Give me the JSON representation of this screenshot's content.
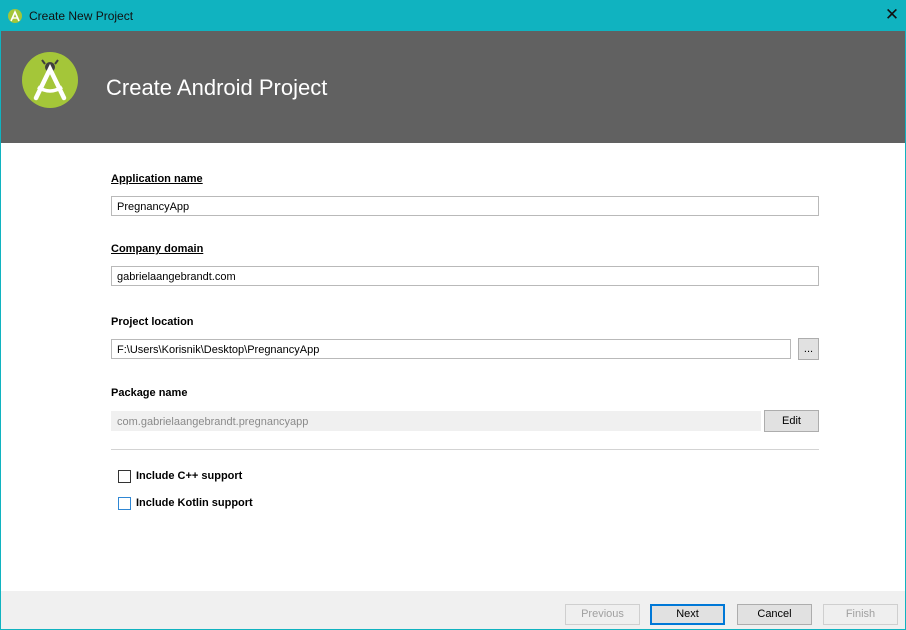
{
  "window": {
    "title": "Create New Project",
    "close_glyph": "✕"
  },
  "banner": {
    "title": "Create Android Project",
    "logo_icon": "android-studio-icon"
  },
  "form": {
    "app_name_label": "Application name",
    "app_name_value": "PregnancyApp",
    "company_domain_label": "Company domain",
    "company_domain_value": "gabrielaangebrandt.com",
    "project_location_label": "Project location",
    "project_location_value": "F:\\Users\\Korisnik\\Desktop\\PregnancyApp",
    "browse_label": "...",
    "package_name_label": "Package name",
    "package_name_value": "com.gabrielaangebrandt.pregnancyapp",
    "edit_label": "Edit",
    "include_cpp_label": "Include C++ support",
    "include_cpp_checked": false,
    "include_kotlin_label": "Include Kotlin support",
    "include_kotlin_checked": false
  },
  "footer": {
    "previous_label": "Previous",
    "next_label": "Next",
    "cancel_label": "Cancel",
    "finish_label": "Finish"
  },
  "colors": {
    "titlebar": "#10b3c0",
    "banner": "#616161",
    "logo_green": "#a4c639",
    "focus_blue": "#0078d7"
  }
}
